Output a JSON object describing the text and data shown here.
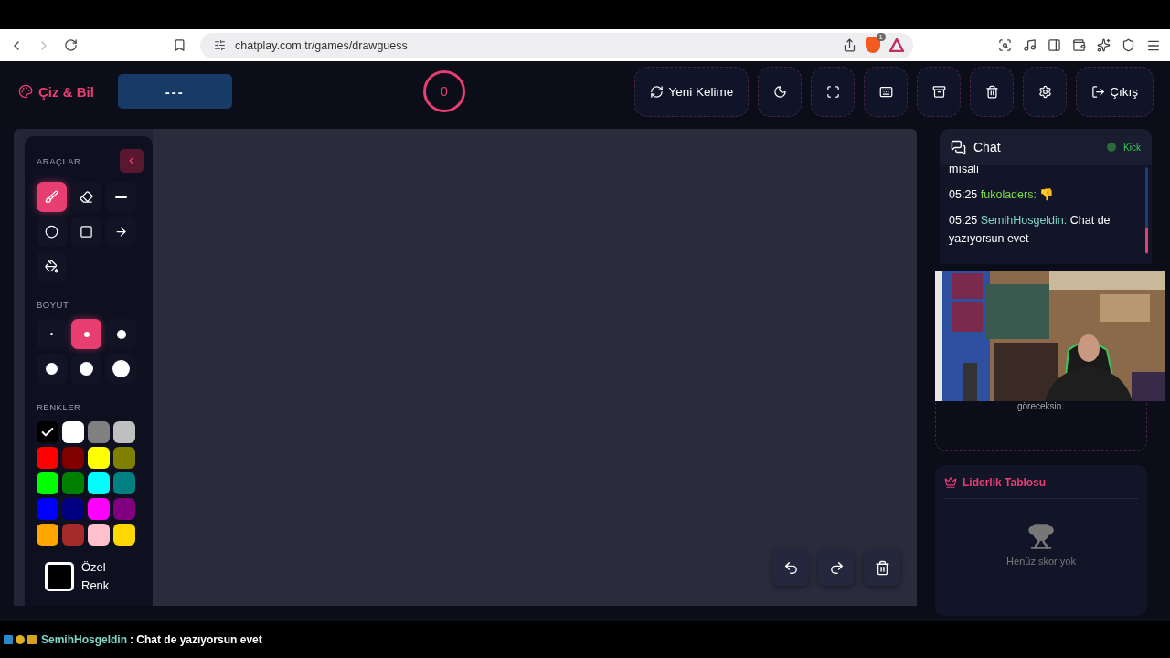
{
  "browser": {
    "url": "chatplay.com.tr/games/drawguess",
    "shield_count": "1"
  },
  "header": {
    "logo": "Çiz & Bil",
    "word": "---",
    "score": "0",
    "buttons": [
      {
        "kind": "refresh",
        "label": "Yeni Kelime"
      },
      {
        "kind": "moon"
      },
      {
        "kind": "expand"
      },
      {
        "kind": "keyboard"
      },
      {
        "kind": "archive"
      },
      {
        "kind": "trash"
      },
      {
        "kind": "gear"
      },
      {
        "kind": "logout",
        "label": "Çıkış"
      }
    ]
  },
  "tools": {
    "title": "ARAÇLAR",
    "items": [
      {
        "kind": "brush",
        "selected": true
      },
      {
        "kind": "eraser",
        "selected": false
      },
      {
        "kind": "line",
        "selected": false
      },
      {
        "kind": "circle",
        "selected": false
      },
      {
        "kind": "square",
        "selected": false
      },
      {
        "kind": "arrow",
        "selected": false
      },
      {
        "kind": "fill",
        "selected": false
      }
    ]
  },
  "sizes": {
    "title": "BOYUT",
    "items": [
      {
        "selected": false
      },
      {
        "selected": true
      },
      {
        "selected": false
      },
      {
        "selected": false
      },
      {
        "selected": false
      },
      {
        "selected": false
      }
    ]
  },
  "colors": {
    "title": "RENKLER",
    "items": [
      {
        "color": "#000000",
        "selected": true
      },
      {
        "color": "#ffffff",
        "selected": false
      },
      {
        "color": "#808080",
        "selected": false
      },
      {
        "color": "#c0c0c0",
        "selected": false
      },
      {
        "color": "#ff0000",
        "selected": false
      },
      {
        "color": "#800000",
        "selected": false
      },
      {
        "color": "#ffff00",
        "selected": false
      },
      {
        "color": "#808000",
        "selected": false
      },
      {
        "color": "#00ff00",
        "selected": false
      },
      {
        "color": "#008000",
        "selected": false
      },
      {
        "color": "#00ffff",
        "selected": false
      },
      {
        "color": "#008080",
        "selected": false
      },
      {
        "color": "#0000ff",
        "selected": false
      },
      {
        "color": "#000080",
        "selected": false
      },
      {
        "color": "#ff00ff",
        "selected": false
      },
      {
        "color": "#800080",
        "selected": false
      },
      {
        "color": "#ffa500",
        "selected": false
      },
      {
        "color": "#a52a2a",
        "selected": false
      },
      {
        "color": "#ffc0cb",
        "selected": false
      },
      {
        "color": "#ffd700",
        "selected": false
      }
    ],
    "custom": {
      "label": "Özel Renk",
      "color": "#000000"
    }
  },
  "canvas_actions": [
    {
      "kind": "undo"
    },
    {
      "kind": "redo"
    },
    {
      "kind": "trash"
    }
  ],
  "chat": {
    "title": "Chat",
    "source": "Kick",
    "messages": [
      {
        "text": "mısalı"
      },
      {
        "time": "05:25",
        "user": "fukoladers:",
        "color": "#7ddc4a",
        "text": "👎"
      },
      {
        "time": "05:25",
        "user": "SemihHosgeldin:",
        "color": "#7fd6c6",
        "text": "Chat de yazıyorsun evet"
      }
    ]
  },
  "video": {
    "kind": "picture",
    "subtitle": "göreceksin."
  },
  "leaderboard": {
    "title": "Liderlik Tablosu",
    "empty": "Henüz skor yok"
  },
  "stream_chat": {
    "user": "SemihHosgeldin",
    "text": ": Chat de yazıyorsun evet"
  }
}
